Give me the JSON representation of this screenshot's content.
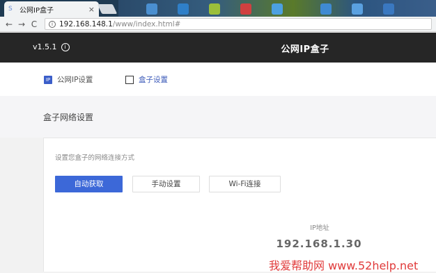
{
  "browser": {
    "tab_title": "公网IP盒子",
    "tab_favicon": "S",
    "url_host": "192.168.148.1",
    "url_path": "/www/index.html#"
  },
  "header": {
    "version": "v1.5.1",
    "title": "公网IP盒子"
  },
  "nav": {
    "items": [
      {
        "label": "公网IP设置",
        "badge": "IP"
      },
      {
        "label": "盒子设置"
      }
    ]
  },
  "section": {
    "title": "盒子网络设置"
  },
  "card": {
    "description": "设置您盒子的网络连接方式",
    "buttons": [
      "自动获取",
      "手动设置",
      "Wi-Fi连接"
    ],
    "ip_label": "IP地址",
    "ip_value": "192.168.1.30"
  },
  "watermark": "我爱帮助网 www.52help.net",
  "colors": {
    "accent": "#3c68d8",
    "header_bg": "#262626"
  }
}
